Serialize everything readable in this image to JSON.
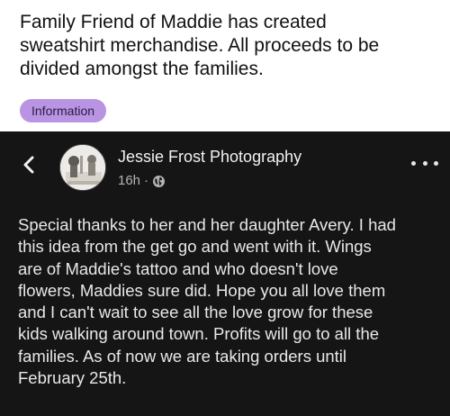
{
  "headline": {
    "lines": [
      "Family Friend of Maddie has created",
      "sweatshirt merchandise. All proceeds to be",
      "divided amongst the families."
    ]
  },
  "badge": {
    "label": "Information"
  },
  "post": {
    "author": "Jessie Frost Photography",
    "time": "16h",
    "separator": "·",
    "audience_icon": "globe-icon",
    "back_icon": "chevron-left-icon",
    "more_icon": "more-options-icon",
    "lines": [
      "Special thanks to her and her daughter Avery. I had",
      "this idea from the get go and went with it. Wings",
      "are of Maddie's tattoo and who doesn't love",
      "flowers, Maddies sure did. Hope you all love them",
      "and I can't wait to see all the love grow for these",
      "kids walking around town. Profits will go to all the",
      "families. As of now we are taking orders until",
      "February 25th."
    ]
  },
  "colors": {
    "post_background": "#151515",
    "badge_background": "#b894e2"
  }
}
